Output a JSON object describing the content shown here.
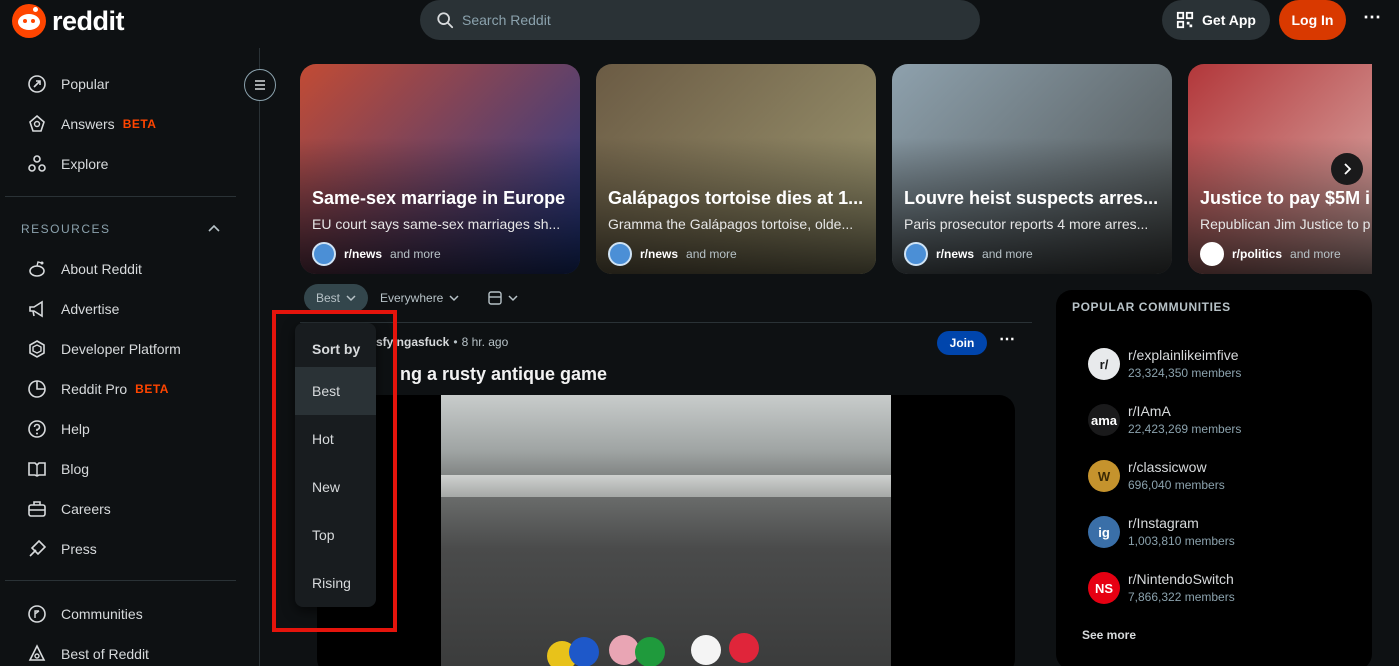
{
  "header": {
    "logo_text": "reddit",
    "search_placeholder": "Search Reddit",
    "get_app_label": "Get App",
    "login_label": "Log In",
    "more_label": "⋯"
  },
  "sidebar": {
    "top_items": [
      {
        "label": "Popular",
        "icon": "popular-icon"
      },
      {
        "label": "Answers",
        "badge": "BETA",
        "icon": "answers-icon"
      },
      {
        "label": "Explore",
        "icon": "explore-icon"
      }
    ],
    "resources_label": "RESOURCES",
    "resource_items": [
      {
        "label": "About Reddit",
        "icon": "about-reddit-icon"
      },
      {
        "label": "Advertise",
        "icon": "advertise-icon"
      },
      {
        "label": "Developer Platform",
        "icon": "developer-platform-icon"
      },
      {
        "label": "Reddit Pro",
        "badge": "BETA",
        "icon": "reddit-pro-icon"
      },
      {
        "label": "Help",
        "icon": "help-icon"
      },
      {
        "label": "Blog",
        "icon": "blog-icon"
      },
      {
        "label": "Careers",
        "icon": "careers-icon"
      },
      {
        "label": "Press",
        "icon": "press-icon"
      }
    ],
    "bottom_items": [
      {
        "label": "Communities",
        "icon": "communities-icon"
      },
      {
        "label": "Best of Reddit",
        "icon": "best-of-reddit-icon"
      }
    ]
  },
  "carousel": [
    {
      "title": "Same-sex marriage in Europe",
      "desc": "EU court says same-sex marriages sh...",
      "sub": "r/news",
      "more": "and more",
      "colors": [
        "#c24b34",
        "#1c3a8f"
      ]
    },
    {
      "title": "Galápagos tortoise dies at 1...",
      "desc": "Gramma the Galápagos tortoise, olde...",
      "sub": "r/news",
      "more": "and more",
      "colors": [
        "#6b5b44",
        "#9f9a73"
      ]
    },
    {
      "title": "Louvre heist suspects arres...",
      "desc": "Paris prosecutor reports 4 more arres...",
      "sub": "r/news",
      "more": "and more",
      "colors": [
        "#8ea1ad",
        "#4b4f4f"
      ]
    },
    {
      "title": "Justice to pay $5M i",
      "desc": "Republican Jim Justice to p",
      "sub": "r/politics",
      "more": "and more",
      "colors": [
        "#b2373a",
        "#e8d3cd"
      ]
    }
  ],
  "sort_bar": {
    "sort_label": "Best",
    "location_label": "Everywhere"
  },
  "dropdown": {
    "heading": "Sort by",
    "items": [
      "Best",
      "Hot",
      "New",
      "Top",
      "Rising"
    ],
    "selected": "Best"
  },
  "post": {
    "subreddit": "sfyingasfuck",
    "separator": "•",
    "time": "8 hr. ago",
    "title": "ng a rusty antique game",
    "join_label": "Join",
    "more_label": "⋯"
  },
  "popular": {
    "heading": "POPULAR COMMUNITIES",
    "communities": [
      {
        "name": "r/explainlikeimfive",
        "members": "23,324,350 members",
        "avatar": "r/",
        "bg": "#e8eaec",
        "fg": "#1a1a1b"
      },
      {
        "name": "r/IAmA",
        "members": "22,423,269 members",
        "avatar": "ama",
        "bg": "#1a1a1b",
        "fg": "#ffffff"
      },
      {
        "name": "r/classicwow",
        "members": "696,040 members",
        "avatar": "W",
        "bg": "#c5932d",
        "fg": "#3b2a05"
      },
      {
        "name": "r/Instagram",
        "members": "1,003,810 members",
        "avatar": "ig",
        "bg": "#3a6fa8",
        "fg": "#ffffff"
      },
      {
        "name": "r/NintendoSwitch",
        "members": "7,866,322 members",
        "avatar": "NS",
        "bg": "#e60012",
        "fg": "#ffffff"
      }
    ],
    "see_more_label": "See more"
  }
}
